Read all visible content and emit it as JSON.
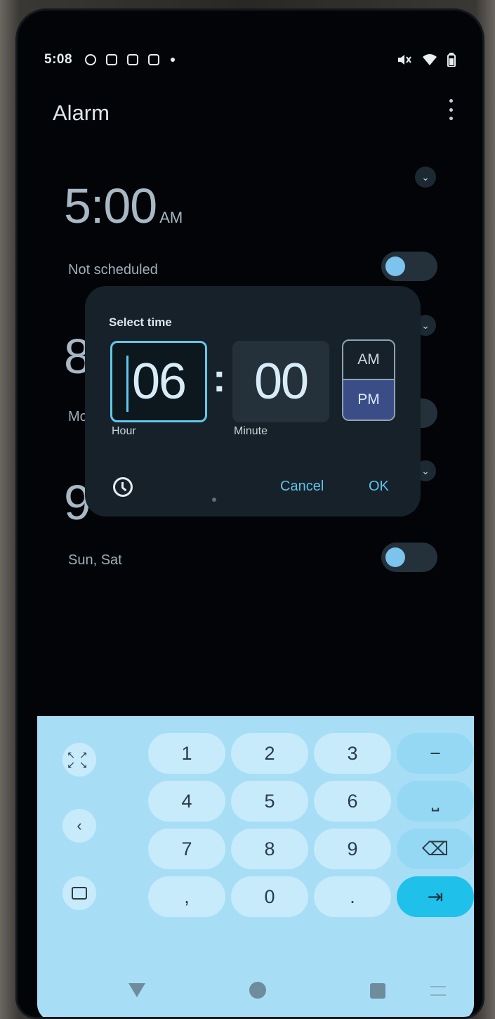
{
  "status_bar": {
    "time": "5:08"
  },
  "app": {
    "title": "Alarm"
  },
  "alarms": [
    {
      "time": "5:00",
      "ampm": "AM",
      "label": "Not scheduled"
    },
    {
      "time": "8",
      "label": "Mo"
    },
    {
      "time": "9",
      "label": "Sun, Sat"
    }
  ],
  "dialog": {
    "title": "Select time",
    "hour": "06",
    "minute": "00",
    "colon": ":",
    "hour_label": "Hour",
    "minute_label": "Minute",
    "am": "AM",
    "pm": "PM",
    "selected_period": "PM",
    "cancel": "Cancel",
    "ok": "OK"
  },
  "keyboard": {
    "keys": [
      "1",
      "2",
      "3",
      "−",
      "4",
      "5",
      "6",
      "⎵",
      "7",
      "8",
      "9",
      "⌫",
      ",",
      "0",
      ".",
      "⇥"
    ],
    "back_symbol": "‹"
  },
  "colors": {
    "accent": "#62c7ea",
    "pm_selected": "#3a4d86",
    "keyboard_bg": "#a7def6",
    "enter_key": "#1fc0ea"
  }
}
